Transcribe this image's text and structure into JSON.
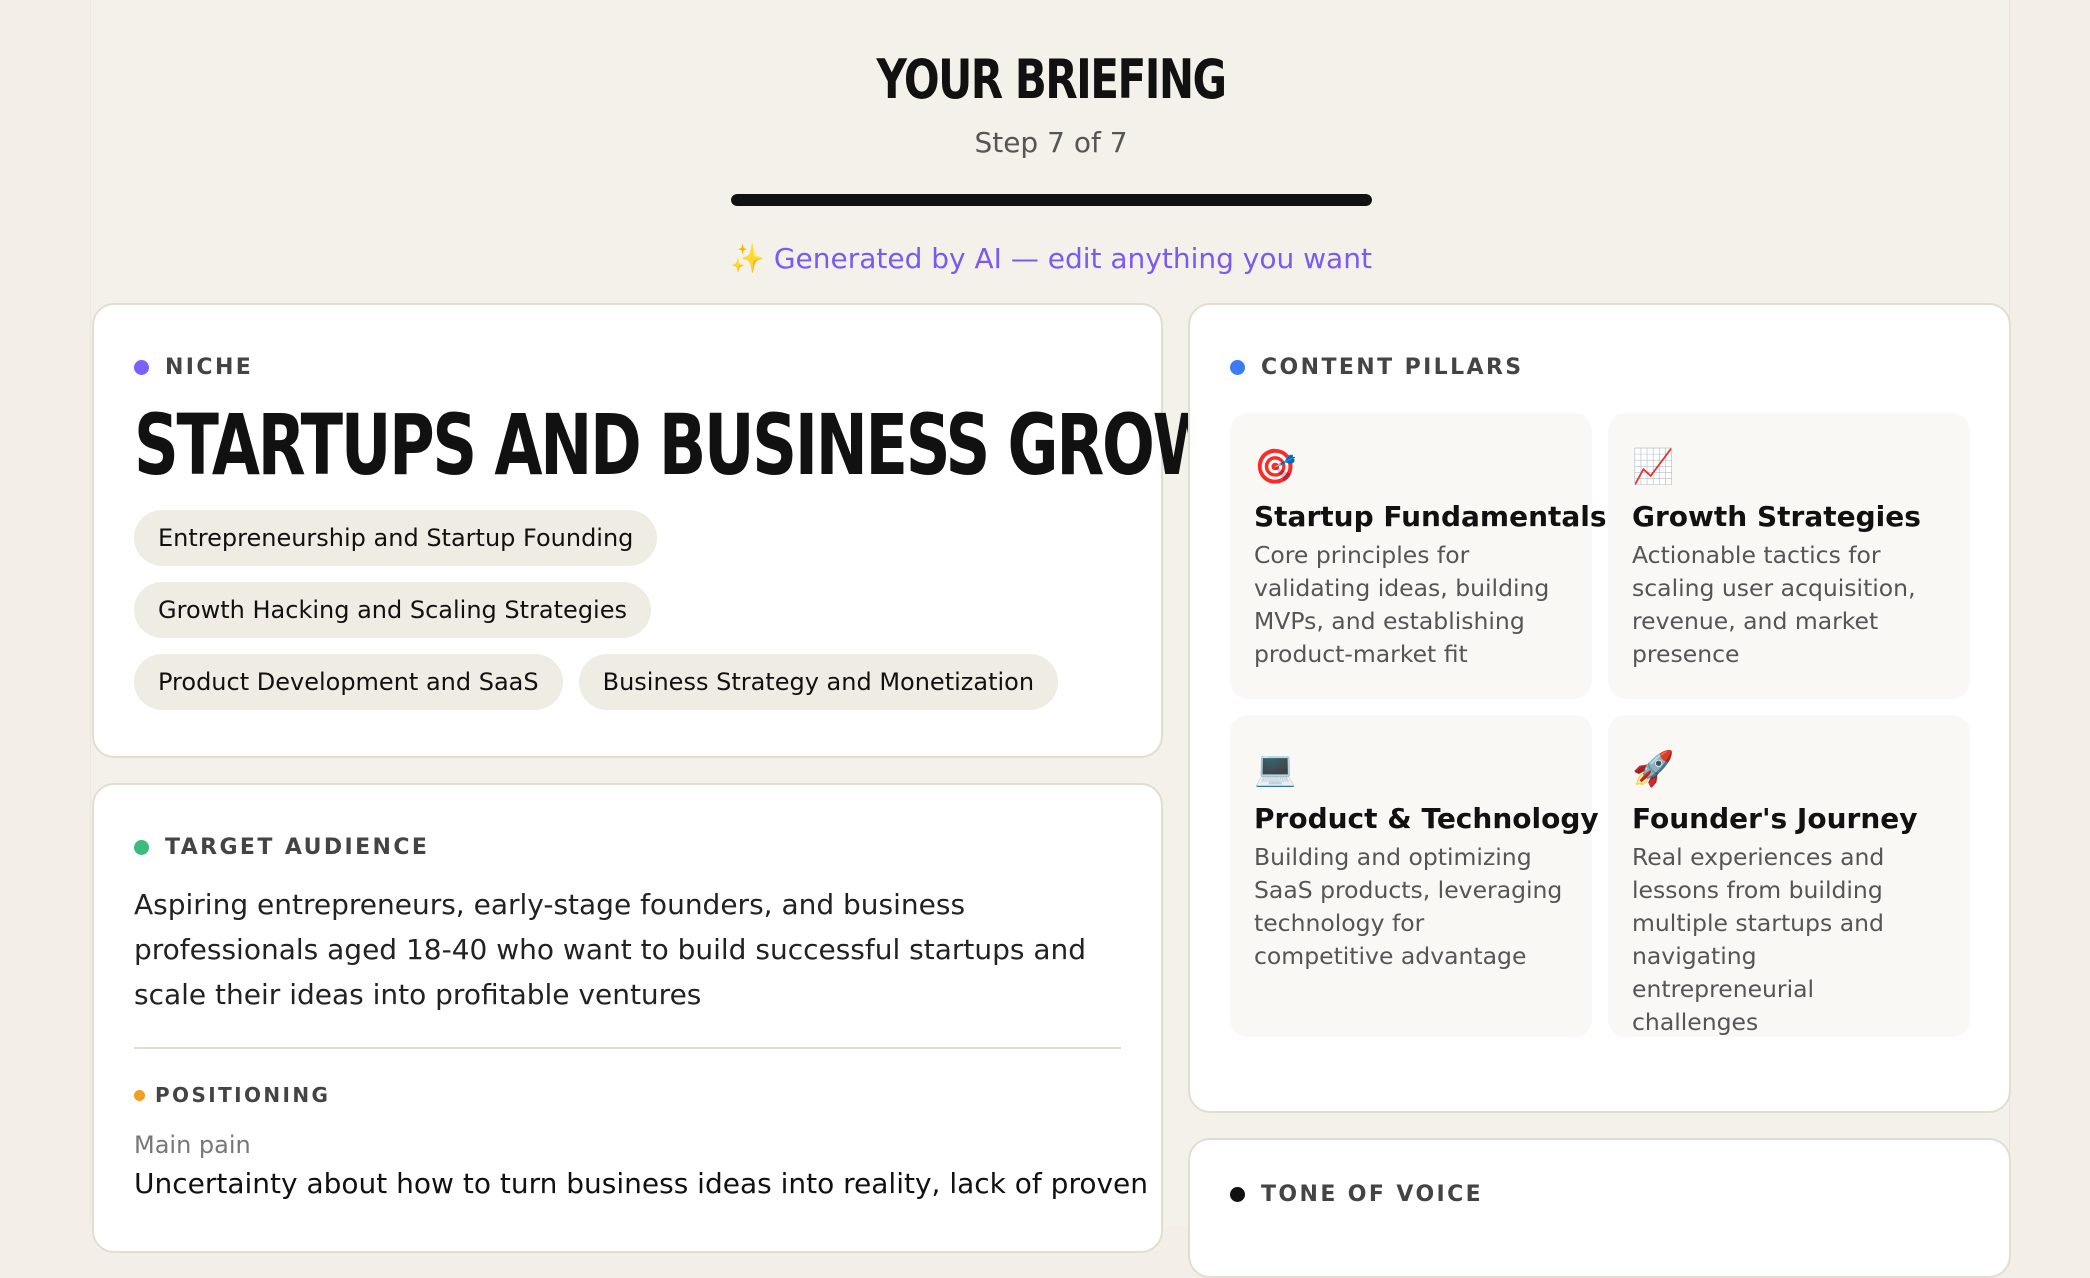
{
  "header": {
    "title": "YOUR BRIEFING",
    "step": "Step 7 of 7",
    "progress_fraction": 1.0,
    "ai_note": "✨ Generated by AI — edit anything you want"
  },
  "niche": {
    "label": "NICHE",
    "title": "STARTUPS AND BUSINESS GROWTH",
    "tags": [
      "Entrepreneurship and Startup Founding",
      "Growth Hacking and Scaling Strategies",
      "Product Development and SaaS",
      "Business Strategy and Monetization"
    ]
  },
  "audience": {
    "label": "TARGET AUDIENCE",
    "text": "Aspiring entrepreneurs, early-stage founders, and business professionals aged 18-40 who want to build successful startups and scale their ideas into profitable ventures"
  },
  "positioning": {
    "label": "POSITIONING",
    "main_pain_label": "Main pain",
    "main_pain_text": "Uncertainty about how to turn business ideas into reality, lack of proven"
  },
  "pillars": {
    "label": "CONTENT PILLARS",
    "items": [
      {
        "icon": "🎯",
        "title": "Startup Fundamentals",
        "desc": "Core principles for validating ideas, building MVPs, and establishing product-market fit"
      },
      {
        "icon": "📈",
        "title": "Growth Strategies",
        "desc": "Actionable tactics for scaling user acquisition, revenue, and market presence"
      },
      {
        "icon": "💻",
        "title": "Product & Technology",
        "desc": "Building and optimizing SaaS products, leveraging technology for competitive advantage"
      },
      {
        "icon": "🚀",
        "title": "Founder's Journey",
        "desc": "Real experiences and lessons from building multiple startups and navigating entrepreneurial challenges"
      }
    ]
  },
  "tone": {
    "label": "TONE OF VOICE"
  },
  "colors": {
    "niche_dot": "#7b61ff",
    "audience_dot": "#3dbb7e",
    "positioning_dot": "#f0a020",
    "pillars_dot": "#3b7cf5",
    "tone_dot": "#111111",
    "accent_purple": "#7a5af0"
  }
}
